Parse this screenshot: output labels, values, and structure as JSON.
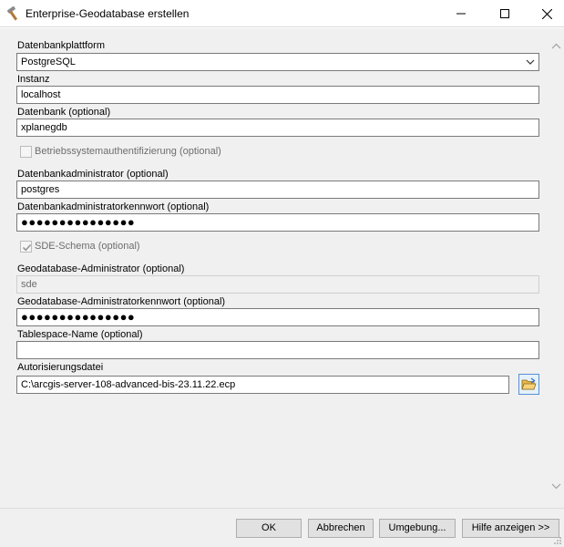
{
  "window": {
    "title": "Enterprise-Geodatabase erstellen",
    "icon": "hammer-icon"
  },
  "form": {
    "platform": {
      "label": "Datenbankplattform",
      "value": "PostgreSQL"
    },
    "instance": {
      "label": "Instanz",
      "value": "localhost"
    },
    "database": {
      "label": "Datenbank (optional)",
      "value": "xplanegdb"
    },
    "os_auth": {
      "label": "Betriebssystemauthentifizierung (optional)",
      "checked": false,
      "enabled": false
    },
    "db_admin": {
      "label": "Datenbankadministrator (optional)",
      "value": "postgres"
    },
    "db_admin_password": {
      "label": "Datenbankadministratorkennwort (optional)",
      "value": "●●●●●●●●●●●●●●●"
    },
    "sde_schema": {
      "label": "SDE-Schema (optional)",
      "checked": true,
      "enabled": false
    },
    "gdb_admin": {
      "label": "Geodatabase-Administrator (optional)",
      "value": "sde"
    },
    "gdb_admin_password": {
      "label": "Geodatabase-Administratorkennwort (optional)",
      "value": "●●●●●●●●●●●●●●●"
    },
    "tablespace": {
      "label": "Tablespace-Name (optional)",
      "value": ""
    },
    "auth_file": {
      "label": "Autorisierungsdatei",
      "value": "C:\\arcgis-server-108-advanced-bis-23.11.22.ecp"
    }
  },
  "buttons": {
    "ok": "OK",
    "cancel": "Abbrechen",
    "environment": "Umgebung...",
    "help": "Hilfe anzeigen >>"
  },
  "colors": {
    "dialog_bg": "#f0f0f0",
    "field_border": "#7a7a7a",
    "disabled_text": "#6d6d6d",
    "accent": "#5a8fd6"
  }
}
